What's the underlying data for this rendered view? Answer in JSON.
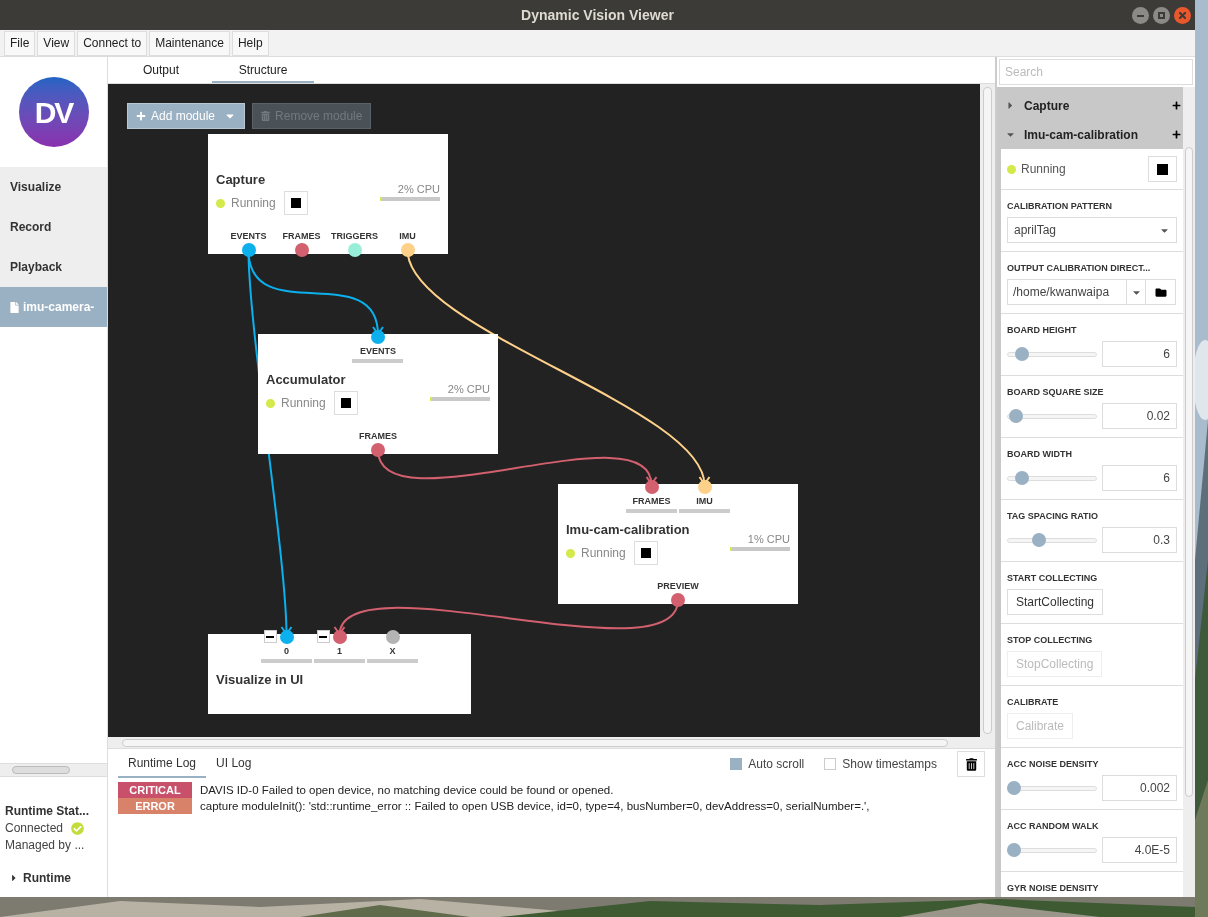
{
  "window": {
    "title": "Dynamic Vision Viewer"
  },
  "menu": [
    "File",
    "View",
    "Connect to",
    "Maintenance",
    "Help"
  ],
  "sidebar": {
    "logo": "DV",
    "items": [
      {
        "label": "Visualize",
        "selected": false,
        "kind": "page"
      },
      {
        "label": "Record",
        "selected": false,
        "kind": "page"
      },
      {
        "label": "Playback",
        "selected": false,
        "kind": "page"
      },
      {
        "label": "imu-camera-",
        "selected": true,
        "kind": "file"
      }
    ],
    "runtime_status": {
      "title": "Runtime Stat...",
      "state": "Connected",
      "connected": true,
      "manager": "Managed by ..."
    },
    "runtime": {
      "label": "Runtime",
      "expanded": false
    }
  },
  "tabs": [
    {
      "label": "Output",
      "selected": false
    },
    {
      "label": "Structure",
      "selected": true
    }
  ],
  "toolbar": {
    "add_module": "Add module",
    "remove_module": {
      "label": "Remove module",
      "disabled": true
    }
  },
  "nodes": [
    {
      "title": "Capture",
      "status": "Running",
      "cpu": "2% CPU",
      "level": 0.04,
      "outputs": [
        {
          "label": "EVENTS",
          "color": "#0bb0ec"
        },
        {
          "label": "FRAMES",
          "color": "#d2606e"
        },
        {
          "label": "TRIGGERS",
          "color": "#98eed8"
        },
        {
          "label": "IMU",
          "color": "#fdd18a"
        }
      ]
    },
    {
      "title": "Accumulator",
      "status": "Running",
      "cpu": "2% CPU",
      "level": 0.04,
      "inputs": [
        {
          "label": "EVENTS",
          "color": "#0bb0ec"
        }
      ],
      "outputs": [
        {
          "label": "FRAMES",
          "color": "#d2606e"
        }
      ]
    },
    {
      "title": "Imu-cam-calibration",
      "status": "Running",
      "cpu": "1% CPU",
      "level": 0.03,
      "inputs": [
        {
          "label": "FRAMES",
          "color": "#d2606e"
        },
        {
          "label": "IMU",
          "color": "#fdd18a"
        }
      ],
      "outputs": [
        {
          "label": "PREVIEW",
          "color": "#d2606e"
        }
      ]
    },
    {
      "title": "Visualize in UI",
      "inputs": [
        {
          "label": "0",
          "color": "#0bb0ec",
          "removable": true
        },
        {
          "label": "1",
          "color": "#d2606e",
          "removable": true
        },
        {
          "label": "X",
          "color": "#b4b4b4"
        }
      ]
    }
  ],
  "log": {
    "tabs": [
      {
        "label": "Runtime Log",
        "selected": true
      },
      {
        "label": "UI Log",
        "selected": false
      }
    ],
    "auto_scroll": {
      "label": "Auto scroll",
      "checked": true
    },
    "show_timestamps": {
      "label": "Show timestamps",
      "checked": false
    },
    "entries": [
      {
        "level": "CRITICAL",
        "color": "#c8506a",
        "message": "DAVIS ID-0 Failed to open device, no matching device could be found or opened."
      },
      {
        "level": "ERROR",
        "color": "#d9826a",
        "message": "capture moduleInit(): 'std::runtime_error :: Failed to open USB device, id=0, type=4, busNumber=0, devAddress=0, serialNumber=.',"
      }
    ]
  },
  "right_panel": {
    "search": {
      "placeholder": "Search"
    },
    "modules": [
      {
        "title": "Capture",
        "expanded": false
      },
      {
        "title": "Imu-cam-calibration",
        "expanded": true
      }
    ],
    "status": "Running",
    "params": [
      {
        "kind": "select",
        "label": "CALIBRATION PATTERN",
        "value": "aprilTag"
      },
      {
        "kind": "path",
        "label": "OUTPUT CALIBRATION DIRECT...",
        "value": "/home/kwanwaipa"
      },
      {
        "kind": "slider",
        "label": "BOARD HEIGHT",
        "value": "6",
        "level": 0.1
      },
      {
        "kind": "slider",
        "label": "BOARD SQUARE SIZE",
        "value": "0.02",
        "level": 0.02
      },
      {
        "kind": "slider",
        "label": "BOARD WIDTH",
        "value": "6",
        "level": 0.1
      },
      {
        "kind": "slider",
        "label": "TAG SPACING RATIO",
        "value": "0.3",
        "level": 0.33
      },
      {
        "kind": "button",
        "label": "START COLLECTING",
        "value": "StartCollecting",
        "disabled": false
      },
      {
        "kind": "button",
        "label": "STOP COLLECTING",
        "value": "StopCollecting",
        "disabled": true
      },
      {
        "kind": "button",
        "label": "CALIBRATE",
        "value": "Calibrate",
        "disabled": true
      },
      {
        "kind": "slider",
        "label": "ACC NOISE DENSITY",
        "value": "0.002",
        "level": 0
      },
      {
        "kind": "slider",
        "label": "ACC RANDOM WALK",
        "value": "4.0E-5",
        "level": 0
      },
      {
        "kind": "heading",
        "label": "GYR NOISE DENSITY"
      }
    ]
  }
}
